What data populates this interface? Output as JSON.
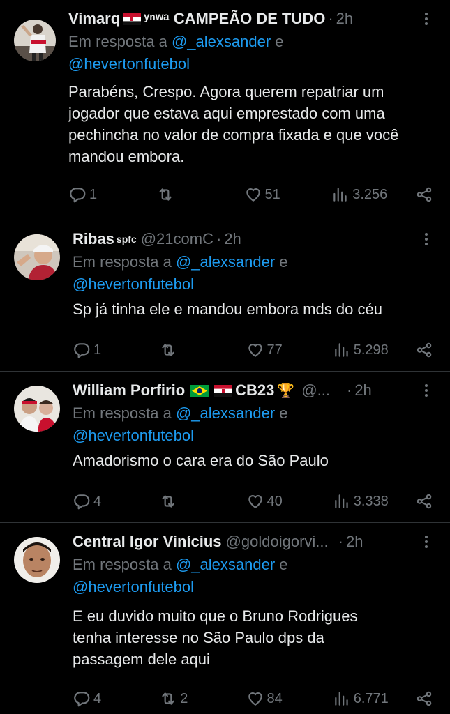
{
  "colors": {
    "background": "#000000",
    "text": "#e7e9ea",
    "secondary": "#71767b",
    "link": "#1d9bf0",
    "divider": "#2f3336"
  },
  "tweets": [
    {
      "name": "Vimarq",
      "name_after_flag1": "ʸⁿʷᵃ CAMPEÃO DE TUDO",
      "handle": "",
      "time": "2h",
      "reply_prefix": "Em resposta a ",
      "mention1": "@_alexsander",
      "reply_and": " e",
      "mention2": "@hevertonfutebol",
      "text": "Parabéns, Crespo. Agora querem repatriar um jogador que estava aqui emprestado com uma pechincha no valor de compra fixada e que você mandou embora.",
      "replies": "1",
      "retweets": "",
      "likes": "51",
      "views": "3.256"
    },
    {
      "name": "Ribas",
      "sup": "spfc",
      "handle": "@21comC",
      "time": "2h",
      "reply_prefix": "Em resposta a ",
      "mention1": "@_alexsander",
      "reply_and": " e",
      "mention2": "@hevertonfutebol",
      "text": "Sp já tinha ele e mandou embora mds do céu",
      "replies": "1",
      "retweets": "",
      "likes": "77",
      "views": "5.298"
    },
    {
      "name": "William Porfirio",
      "name_suffix": "CB23",
      "trophy": "🏆",
      "handle": "@...",
      "time": "2h",
      "reply_prefix": "Em resposta a ",
      "mention1": "@_alexsander",
      "reply_and": " e",
      "mention2": "@hevertonfutebol",
      "text": "Amadorismo o cara era do São Paulo",
      "replies": "4",
      "retweets": "",
      "likes": "40",
      "views": "3.338"
    },
    {
      "name": "Central Igor Vinícius",
      "handle": "@goldoigorvi...",
      "time": "2h",
      "reply_prefix": "Em resposta a ",
      "mention1": "@_alexsander",
      "reply_and": " e",
      "mention2": "@hevertonfutebol",
      "text": "E eu duvido muito que o Bruno Rodrigues tenha interesse no São Paulo dps da passagem dele aqui",
      "replies": "4",
      "retweets": "2",
      "likes": "84",
      "views": "6.771"
    }
  ],
  "separator_dot": "·",
  "icons": [
    "reply-icon",
    "retweet-icon",
    "heart-icon",
    "views-icon",
    "share-icon",
    "more-icon",
    "sao-paulo-flag-icon",
    "brazil-flag-icon"
  ]
}
